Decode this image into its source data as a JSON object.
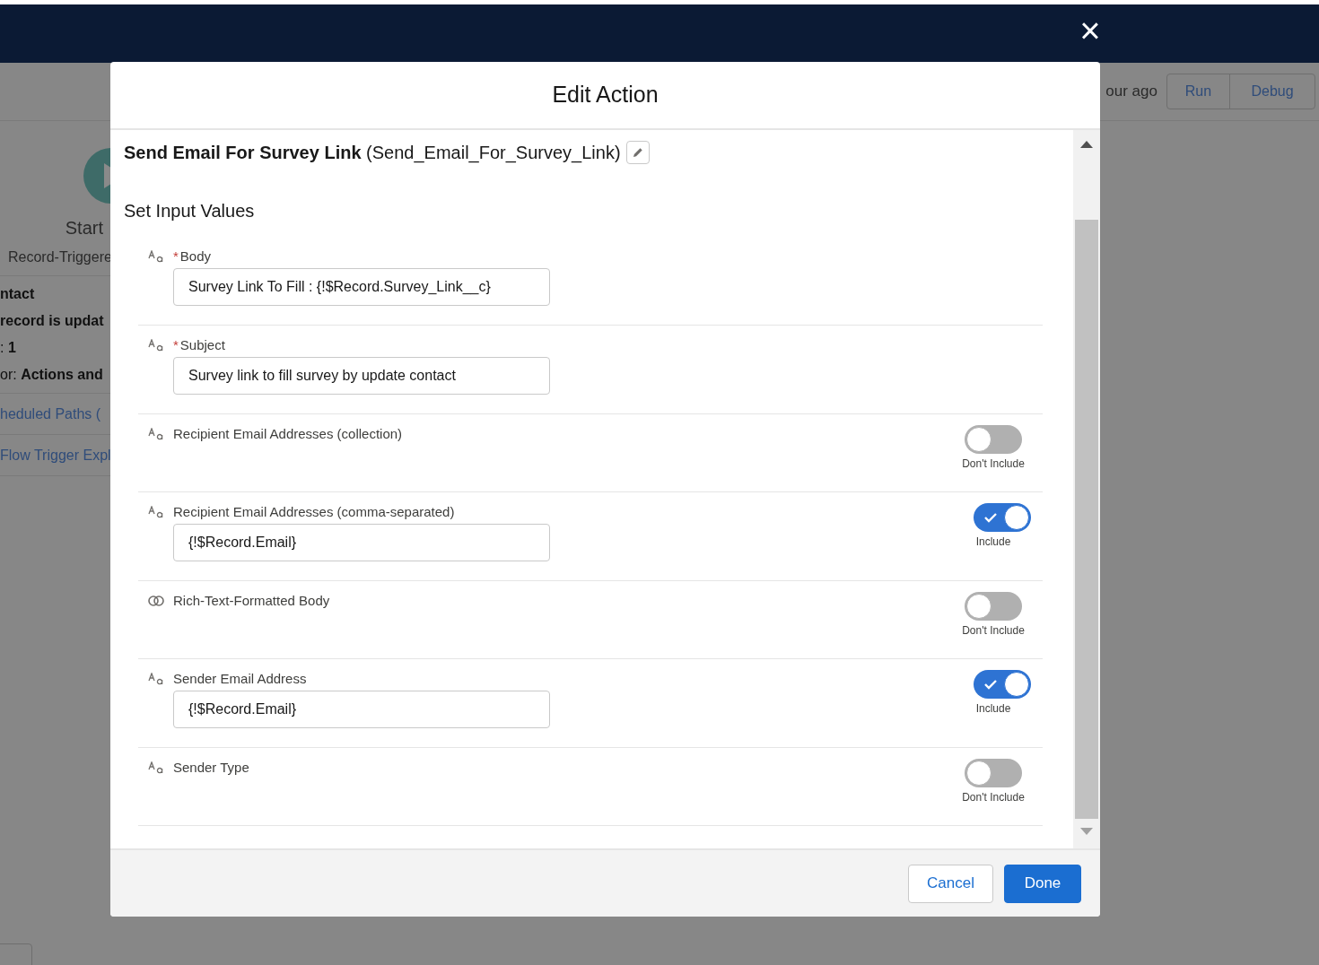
{
  "background": {
    "start": {
      "title": "Start",
      "subtitle": "Record-Triggere"
    },
    "details": [
      {
        "text": "ntact",
        "bold": true
      },
      {
        "text": "record is updat",
        "bold": true
      },
      {
        "text": ": **1**",
        "bold": false
      },
      {
        "text": "or: **Actions and**",
        "bold": false
      }
    ],
    "links": [
      "heduled Paths (",
      "Flow Trigger Expl"
    ],
    "modified": "our ago",
    "buttons": [
      "Run",
      "Debug"
    ]
  },
  "close_label": "×",
  "modal": {
    "title": "Edit Action",
    "action_name": "Send Email For Survey Link",
    "api_name": "(Send_Email_For_Survey_Link)",
    "section": "Set Input Values",
    "fields": [
      {
        "kind": "text",
        "label": "Body",
        "required_mark": "*",
        "value": "Survey Link To Fill : {!$Record.Survey_Link__c}"
      },
      {
        "kind": "text",
        "label": "Subject",
        "required_mark": "*",
        "value": "Survey link to fill survey by update contact"
      },
      {
        "kind": "text",
        "label": "Recipient Email Addresses (collection)",
        "toggle": {
          "on": false,
          "label": "Don't Include"
        }
      },
      {
        "kind": "text",
        "label": "Recipient Email Addresses (comma-separated)",
        "value": "{!$Record.Email}",
        "toggle": {
          "on": true,
          "label": "Include"
        }
      },
      {
        "kind": "boolean",
        "label": "Rich-Text-Formatted Body",
        "toggle": {
          "on": false,
          "label": "Don't Include"
        }
      },
      {
        "kind": "text",
        "label": "Sender Email Address",
        "value": "{!$Record.Email}",
        "toggle": {
          "on": true,
          "label": "Include"
        }
      },
      {
        "kind": "text",
        "label": "Sender Type",
        "toggle": {
          "on": false,
          "label": "Don't Include"
        }
      }
    ],
    "buttons": [
      {
        "label": "Cancel",
        "kind": "secondary"
      },
      {
        "label": "Done",
        "kind": "primary"
      }
    ]
  }
}
